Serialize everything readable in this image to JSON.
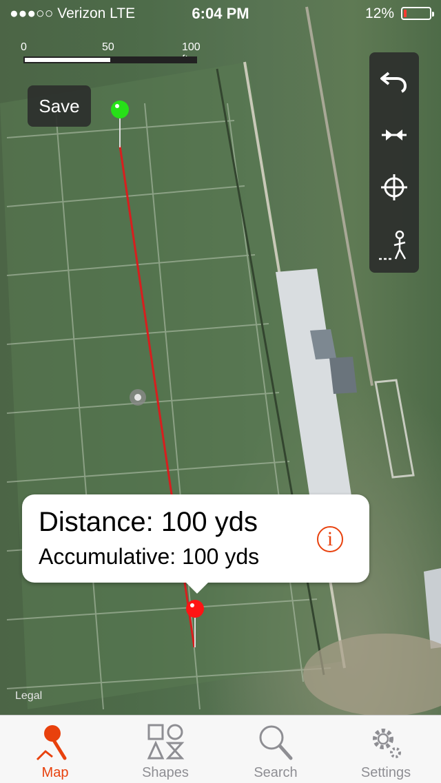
{
  "status_bar": {
    "carrier": "●●●○○ Verizon  LTE",
    "time": "6:04 PM",
    "battery_percent": "12%",
    "battery_level": 0.12,
    "battery_color": "#ff3b30"
  },
  "map": {
    "scale_bar": {
      "labels": [
        "0",
        "50",
        "100 ft"
      ]
    },
    "save_label": "Save",
    "legal_label": "Legal",
    "start_pin_color": "#27e018",
    "end_pin_color": "#ff1414",
    "line_color": "#d81e1e",
    "callout": {
      "distance": "Distance: 100 yds",
      "accumulative": "Accumulative: 100 yds",
      "info_icon": "i"
    },
    "tools": [
      "undo-icon",
      "collapse-arrows-icon",
      "crosshair-icon",
      "walking-person-icon"
    ]
  },
  "tabbar": {
    "accent_color": "#e8410d",
    "tabs": [
      {
        "label": "Map",
        "icon": "map-pin-icon",
        "active": true
      },
      {
        "label": "Shapes",
        "icon": "shapes-icon",
        "active": false
      },
      {
        "label": "Search",
        "icon": "magnifier-icon",
        "active": false
      },
      {
        "label": "Settings",
        "icon": "gear-icon",
        "active": false
      }
    ]
  }
}
